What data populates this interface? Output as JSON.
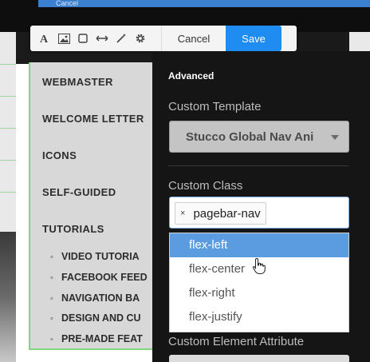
{
  "topbar": {
    "label": "Cancel"
  },
  "toolbar": {
    "icons": [
      "text-icon",
      "image-icon",
      "box-icon",
      "width-icon",
      "magic-wand-icon",
      "gear-icon"
    ],
    "cancel_label": "Cancel",
    "save_label": "Save"
  },
  "pagenav": {
    "items": [
      "WEBMASTER",
      "WELCOME LETTER",
      "ICONS",
      "SELF-GUIDED",
      "TUTORIALS"
    ],
    "subitems": [
      "VIDEO TUTORIA",
      "FACEBOOK FEED",
      "NAVIGATION BA",
      "DESIGN AND CU",
      "PRE-MADE FEAT"
    ]
  },
  "panel": {
    "title": "Advanced",
    "template_label": "Custom Template",
    "template_value": "Stucco Global Nav Ani",
    "class_label": "Custom Class",
    "class_tag": "pagebar-nav",
    "class_tag_remove": "×",
    "options": [
      "flex-left",
      "flex-center",
      "flex-right",
      "flex-justify"
    ],
    "highlighted_option": "flex-left",
    "attribute_label": "Custom Element Attribute"
  },
  "colors": {
    "accent": "#1e8cf0",
    "highlight": "#5b9be0",
    "panel_bg": "#151515",
    "nav_border": "#7fd47f"
  }
}
